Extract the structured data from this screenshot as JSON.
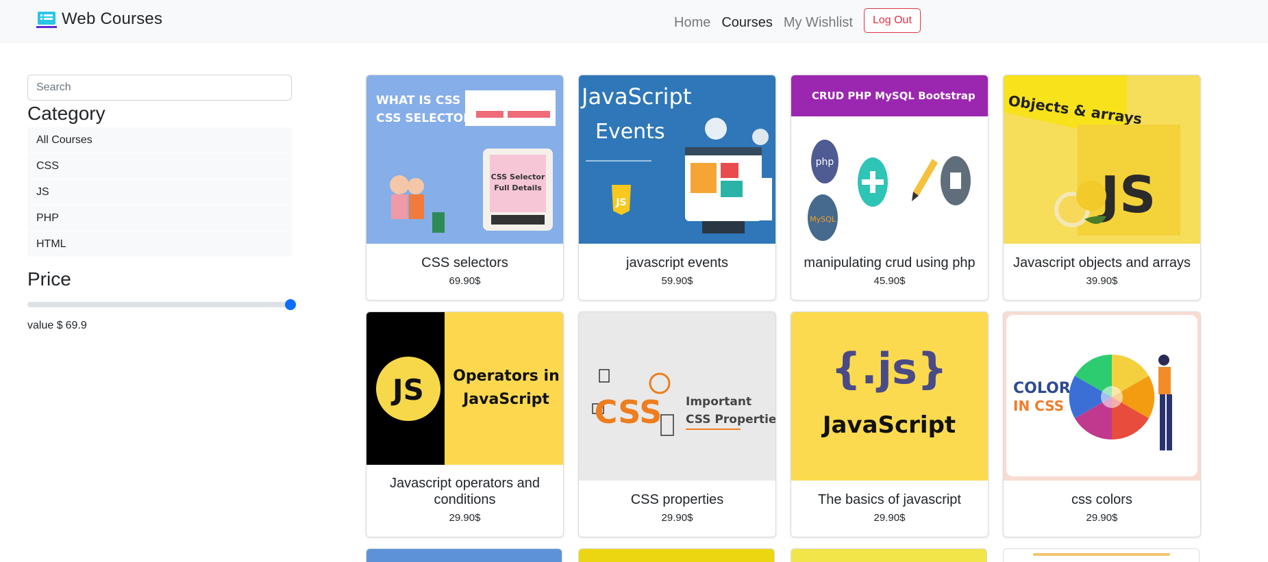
{
  "navbar": {
    "brand": "Web Courses",
    "links": [
      {
        "label": "Home",
        "active": false
      },
      {
        "label": "Courses",
        "active": true
      },
      {
        "label": "My Wishlist",
        "active": false
      }
    ],
    "logout_label": "Log Out"
  },
  "sidebar": {
    "search_placeholder": "Search",
    "category_heading": "Category",
    "categories": [
      "All Courses",
      "CSS",
      "JS",
      "PHP",
      "HTML"
    ],
    "price_heading": "Price",
    "price_slider_fraction": 0.995,
    "value_label": "value $",
    "value": "69.9"
  },
  "courses": [
    {
      "title": "CSS selectors",
      "price": "69.90$",
      "image": "css-selector-thumbnail",
      "image_text": [
        "WHAT IS CSS ?",
        "CSS SELECTOR ?",
        "CSS Selector",
        "Full Details"
      ]
    },
    {
      "title": "javascript events",
      "price": "59.90$",
      "image": "javascript-events-thumbnail",
      "image_text": [
        "JavaScript",
        "Events",
        "JS"
      ]
    },
    {
      "title": "manipulating crud using php",
      "price": "45.90$",
      "image": "crud-php-thumbnail",
      "image_text": [
        "CRUD PHP MySQL Bootstrap",
        "php",
        "MySQL"
      ]
    },
    {
      "title": "Javascript objects and arrays",
      "price": "39.90$",
      "image": "js-objects-arrays-thumbnail",
      "image_text": [
        "Objects & arrays",
        "JS"
      ]
    },
    {
      "title": "Javascript operators and conditions",
      "price": "29.90$",
      "image": "js-operators-thumbnail",
      "image_text": [
        "JS",
        "Operators in",
        "JavaScript"
      ]
    },
    {
      "title": "CSS properties",
      "price": "29.90$",
      "image": "css-properties-thumbnail",
      "image_text": [
        "CSS",
        "Important",
        "CSS Properties"
      ]
    },
    {
      "title": "The basics of javascript",
      "price": "29.90$",
      "image": "js-basics-thumbnail",
      "image_text": [
        "{.js}",
        "JavaScript"
      ]
    },
    {
      "title": "css colors",
      "price": "29.90$",
      "image": "css-colors-thumbnail",
      "image_text": [
        "COLOR",
        "IN CSS"
      ]
    }
  ],
  "colors": {
    "primary": "#0d6efd",
    "danger": "#dc3545",
    "navbar_bg": "#f8f9fa",
    "js_yellow": "#f7df1e"
  }
}
